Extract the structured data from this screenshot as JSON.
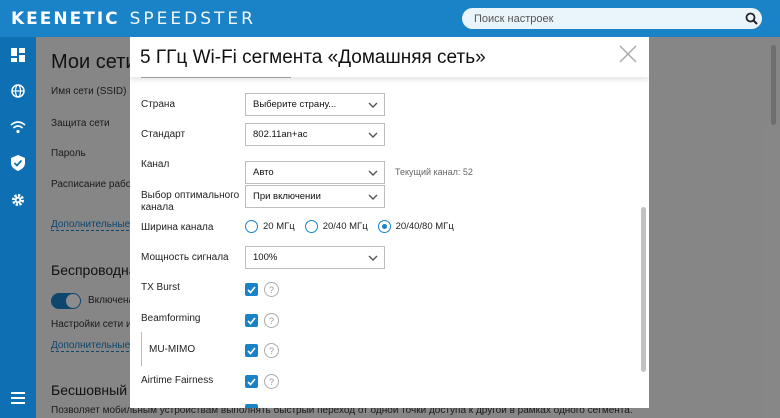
{
  "brand": {
    "name_bold": "KEENETIC",
    "name_thin": "SPEEDSTER"
  },
  "search": {
    "placeholder": "Поиск настроек",
    "icon": "search-icon"
  },
  "sidebar": {
    "items": [
      {
        "icon": "dashboard-icon"
      },
      {
        "icon": "globe-icon"
      },
      {
        "icon": "wifi-icon"
      },
      {
        "icon": "shield-icon"
      },
      {
        "icon": "gear-icon"
      },
      {
        "icon": "menu-icon"
      }
    ]
  },
  "background": {
    "title": "Мои сети",
    "labels": [
      "Имя сети (SSID)",
      "Защита сети",
      "Пароль",
      "Расписание работы"
    ],
    "link_more": "Дополнительные на",
    "section_wireless": "Беспроводная с",
    "toggle_label": "Включена",
    "settings_label": "Настройки сети иде",
    "link_more2": "Дополнительные на",
    "section_seamless": "Бесшовный ро",
    "seamless_text": "Позволяет мобильным устройствам выполнять быстрый переход от одной точки доступа к другой в рамках одного сегмента."
  },
  "modal": {
    "title": "5 ГГц Wi-Fi сегмента «Домашняя сеть»",
    "fields": {
      "country": {
        "label": "Страна",
        "value": "Выберите страну..."
      },
      "standard": {
        "label": "Стандарт",
        "value": "802.11an+ac"
      },
      "channel": {
        "label": "Канал",
        "value": "Авто",
        "hint": "Текущий канал: 52"
      },
      "optimal_channel": {
        "label": "Выбор оптимального канала",
        "value": "При включении"
      },
      "bandwidth": {
        "label": "Ширина канала",
        "options": [
          "20 МГц",
          "20/40 МГц",
          "20/40/80 МГц"
        ],
        "selected": "20/40/80 МГц"
      },
      "power": {
        "label": "Мощность сигнала",
        "value": "100%"
      },
      "tx_burst": {
        "label": "TX Burst",
        "checked": true
      },
      "beamforming": {
        "label": "Beamforming",
        "checked": true
      },
      "mu_mimo": {
        "label": "MU-MIMO",
        "checked": true
      },
      "airtime": {
        "label": "Airtime Fairness",
        "checked": true
      }
    },
    "help": "?"
  },
  "colors": {
    "accent": "#1a82c7",
    "sidebar": "#0e70b2"
  }
}
